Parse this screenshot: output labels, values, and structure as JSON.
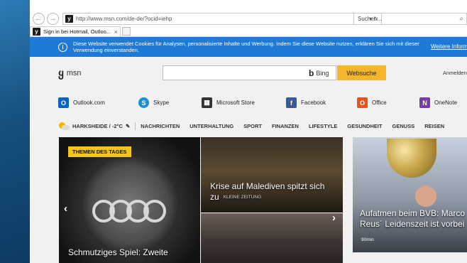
{
  "browser": {
    "back_glyph": "←",
    "forward_glyph": "→",
    "favicon_glyph": "y",
    "address_url": "http://www.msn.com/de-de/?ocid=iehp",
    "address_icons": "▾ ↻",
    "search_placeholder": "Suchen...",
    "search_icon_glyph": "⌕",
    "tab_title": "Sign in bei Hotmail, Outloo...",
    "tab_close": "×"
  },
  "cookie_banner": {
    "info_glyph": "i",
    "message": "Diese Website verwendet Cookies für Analysen, personalisierte Inhalte und Werbung. Indem Sie diese Website nutzen, erklären Sie sich mit dieser Verwendung einverstanden.",
    "more_link": "Weitere Inform"
  },
  "header": {
    "logo_glyph": "ყ",
    "logo_text": "msn",
    "bing_glyph": "b",
    "bing_label": "Bing",
    "search_button": "Websuche",
    "signin": "Anmelden"
  },
  "quicklinks": [
    {
      "label": "Outlook.com",
      "icon": "outlook-icon",
      "glyph": "O",
      "color": "#0a64c2"
    },
    {
      "label": "Skype",
      "icon": "skype-icon",
      "glyph": "S",
      "color": "#1a8fd6"
    },
    {
      "label": "Microsoft Store",
      "icon": "store-icon",
      "glyph": "▦",
      "color": "#333333"
    },
    {
      "label": "Facebook",
      "icon": "facebook-icon",
      "glyph": "f",
      "color": "#3b5998"
    },
    {
      "label": "Office",
      "icon": "office-icon",
      "glyph": "O",
      "color": "#e8541e"
    },
    {
      "label": "OneNote",
      "icon": "onenote-icon",
      "glyph": "N",
      "color": "#7b3aa6"
    }
  ],
  "categories": {
    "weather_label": "HARKSHEIDE / -2°C",
    "edit_glyph": "✎",
    "items": [
      "NACHRICHTEN",
      "UNTERHALTUNG",
      "SPORT",
      "FINANZEN",
      "LIFESTYLE",
      "GESUNDHEIT",
      "GENUSS",
      "REISEN"
    ]
  },
  "tiles": {
    "t1_badge": "THEMEN DES TAGES",
    "t1_title": "Schmutziges Spiel: Zweite",
    "arrow_left": "‹",
    "arrow_right": "›",
    "t2_title_line1": "Krise auf Malediven spitzt sich",
    "t2_title_line2": "zu",
    "t2_source": "KLEINE ZEITUNG",
    "t4_title_line1": "Aufatmen beim BVB: Marco",
    "t4_title_line2": "Reus´ Leidenszeit ist vorbei",
    "t4_time": "90min"
  },
  "colors": {
    "accent": "#1e7ad6",
    "search_button": "#f5b62e",
    "badge": "#f5c518"
  }
}
